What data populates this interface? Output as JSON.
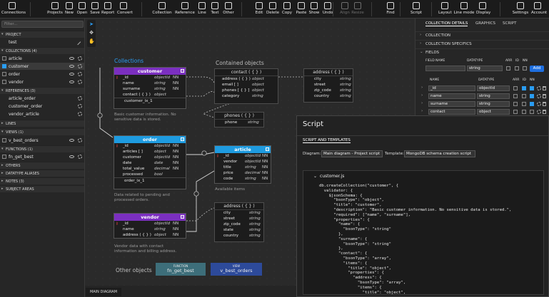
{
  "toolbar": {
    "items": [
      {
        "label": "Connections",
        "icon": "connections-icon",
        "enabled": true
      },
      {
        "label": "Projects",
        "icon": "projects-icon",
        "enabled": true
      },
      {
        "label": "New",
        "icon": "new-icon",
        "enabled": true
      },
      {
        "label": "Open",
        "icon": "open-icon",
        "enabled": true
      },
      {
        "label": "Save",
        "icon": "save-icon",
        "enabled": true
      },
      {
        "label": "Report",
        "icon": "report-icon",
        "enabled": true
      },
      {
        "label": "Convert",
        "icon": "convert-icon",
        "enabled": true
      },
      {
        "label": "Collection",
        "icon": "collection-icon",
        "enabled": true
      },
      {
        "label": "Reference",
        "icon": "reference-icon",
        "enabled": true
      },
      {
        "label": "Line",
        "icon": "line-icon",
        "enabled": true
      },
      {
        "label": "Text",
        "icon": "text-icon",
        "enabled": true
      },
      {
        "label": "Other",
        "icon": "other-icon",
        "enabled": true
      },
      {
        "label": "Edit",
        "icon": "edit-icon",
        "enabled": true
      },
      {
        "label": "Delete",
        "icon": "delete-icon",
        "enabled": true
      },
      {
        "label": "Copy",
        "icon": "copy-icon",
        "enabled": true
      },
      {
        "label": "Paste",
        "icon": "paste-icon",
        "enabled": true
      },
      {
        "label": "Show",
        "icon": "show-icon",
        "enabled": true
      },
      {
        "label": "Undo",
        "icon": "undo-icon",
        "enabled": true
      },
      {
        "label": "Align",
        "icon": "align-icon",
        "enabled": false
      },
      {
        "label": "Resize",
        "icon": "resize-icon",
        "enabled": false
      },
      {
        "label": "Find",
        "icon": "find-icon",
        "enabled": true
      },
      {
        "label": "Script",
        "icon": "script-icon",
        "enabled": true
      },
      {
        "label": "Layout",
        "icon": "layout-icon",
        "enabled": true
      },
      {
        "label": "Line mode",
        "icon": "line-mode-icon",
        "enabled": true
      },
      {
        "label": "Display",
        "icon": "display-icon",
        "enabled": true
      },
      {
        "label": "Settings",
        "icon": "settings-icon",
        "enabled": true
      },
      {
        "label": "Account",
        "icon": "account-icon",
        "enabled": true
      }
    ]
  },
  "left": {
    "search_placeholder": "Filter...",
    "project_header": "PROJECT",
    "project_name": "test",
    "collections_header": "COLLECTIONS",
    "collections_count": "(4)",
    "collections": [
      {
        "name": "article",
        "checked": false
      },
      {
        "name": "customer",
        "checked": true
      },
      {
        "name": "order",
        "checked": false
      },
      {
        "name": "vendor",
        "checked": false
      }
    ],
    "references_header": "REFERENCES",
    "references_count": "(3)",
    "references": [
      "article_order",
      "customer_order",
      "vendor_article"
    ],
    "lines_header": "LINES",
    "views_header": "VIEWS",
    "views_count": "(1)",
    "views": [
      "v_best_orders"
    ],
    "functions_header": "FUNCTIONS",
    "functions_count": "(1)",
    "functions": [
      "fn_get_best"
    ],
    "others_header": "OTHERS",
    "datatype_header": "DATATYPE ALIASES",
    "notes_header": "NOTES",
    "notes_count": "(3)",
    "subject_header": "SUBJECT AREAS"
  },
  "diagram": {
    "collections_title": "Collections",
    "contained_title": "Contained objects",
    "other_title": "Other objects",
    "customer": {
      "name": "customer",
      "color": "#7b2fc0",
      "rows": [
        {
          "key": "🔑",
          "name": "_id",
          "type": "objectId",
          "flag": "NN"
        },
        {
          "key": "",
          "name": "name",
          "type": "string",
          "flag": "NN"
        },
        {
          "key": "",
          "name": "surname",
          "type": "string",
          "flag": "NN"
        },
        {
          "key": "",
          "name": "contact ( { } )",
          "type": "object",
          "flag": ""
        }
      ],
      "index": "customer_ix_1",
      "note": "Basic customer information. No sensitive data is stored."
    },
    "order": {
      "name": "order",
      "color": "#1e9be0",
      "rows": [
        {
          "key": "🔑",
          "name": "_id",
          "type": "objectId",
          "flag": "NN"
        },
        {
          "key": "",
          "name": "articles [ ]",
          "type": "object",
          "flag": "NN"
        },
        {
          "key": "",
          "name": "customer",
          "type": "objectId",
          "flag": "NN"
        },
        {
          "key": "",
          "name": "date",
          "type": "date",
          "flag": "NN"
        },
        {
          "key": "",
          "name": "total_value",
          "type": "decimal",
          "flag": "NN"
        },
        {
          "key": "",
          "name": "processed",
          "type": "bool",
          "flag": ""
        }
      ],
      "index": "order_ix_1",
      "note": "Data related to pending and processed orders."
    },
    "vendor": {
      "name": "vendor",
      "color": "#7b2fc0",
      "rows": [
        {
          "key": "🔑",
          "name": "_id",
          "type": "objectId",
          "flag": "NN"
        },
        {
          "key": "",
          "name": "name",
          "type": "string",
          "flag": "NN"
        },
        {
          "key": "",
          "name": "address ( { } )",
          "type": "object",
          "flag": "NN"
        }
      ],
      "note": "Vendor data with contact information and billing address."
    },
    "article": {
      "name": "article",
      "color": "#1e9be0",
      "rows": [
        {
          "key": "🔑",
          "name": "_id",
          "type": "objectId",
          "flag": "NN"
        },
        {
          "key": "",
          "name": "vendor",
          "type": "objectId",
          "flag": "NN"
        },
        {
          "key": "",
          "name": "title",
          "type": "string",
          "flag": "NN"
        },
        {
          "key": "",
          "name": "price",
          "type": "decimal",
          "flag": "NN"
        },
        {
          "key": "",
          "name": "code",
          "type": "string",
          "flag": "NN"
        }
      ],
      "note": "Available items"
    },
    "contact": {
      "name": "contact ( { } )",
      "rows": [
        {
          "name": "address ( { } )",
          "type": "object"
        },
        {
          "name": "email [ ]",
          "type": "object"
        },
        {
          "name": "phones [ { } ]",
          "type": "object"
        },
        {
          "name": "category",
          "type": "string"
        }
      ]
    },
    "address1": {
      "name": "address ( { } )",
      "rows": [
        {
          "name": "city",
          "type": "string"
        },
        {
          "name": "street",
          "type": "string"
        },
        {
          "name": "zip_code",
          "type": "string"
        },
        {
          "name": "country",
          "type": "string"
        }
      ]
    },
    "phones": {
      "name": "phones ( { } )",
      "rows": [
        {
          "name": "phone",
          "type": "string"
        }
      ]
    },
    "address2": {
      "name": "address ( { } )",
      "rows": [
        {
          "name": "city",
          "type": "string"
        },
        {
          "name": "street",
          "type": "string"
        },
        {
          "name": "zip_code",
          "type": "string"
        },
        {
          "name": "state",
          "type": "string"
        },
        {
          "name": "country",
          "type": "string"
        }
      ]
    },
    "fn_box": {
      "caption": "FUNCTION",
      "name": "fn_get_best",
      "color": "#3d6e7a"
    },
    "view_box": {
      "caption": "VIEW",
      "name": "v_best_orders",
      "color": "#2d4a9a"
    },
    "bottom_tab": "MAIN DIAGRAM"
  },
  "right": {
    "tabs": [
      "COLLECTION DETAILS",
      "GRAPHICS",
      "SCRIPT"
    ],
    "sections": [
      "COLLECTION",
      "COLLECTION SPECIFICS",
      "FIELDS"
    ],
    "field_name_label": "FIELD NAME",
    "datatype_label": "DATATYPE",
    "arr_label": "ARR",
    "id_label": "ID",
    "nn_label": "NN",
    "new_datatype": "string",
    "add_label": "Add",
    "header_name": "NAME",
    "header_datatype": "DATATYPE",
    "fields": [
      {
        "name": "_id",
        "type": "objectId",
        "arr": false,
        "id": true,
        "nn": true
      },
      {
        "name": "name",
        "type": "string",
        "arr": false,
        "id": false,
        "nn": true
      },
      {
        "name": "surname",
        "type": "string",
        "arr": false,
        "id": false,
        "nn": true
      },
      {
        "name": "contact",
        "type": "object",
        "arr": false,
        "id": false,
        "nn": false
      }
    ]
  },
  "script": {
    "title": "Script",
    "tab": "SCRIPT AND TEMPLATES",
    "diagram_label": "Diagram:",
    "diagram_value": "Main diagram - Project script",
    "template_label": "Template:",
    "template_value": "MongoDB schema creation script",
    "file": "customer.js",
    "lines": [
      "db.createCollection(\"customer\", {",
      "  validator: {",
      "    $jsonSchema: {",
      "      \"bsonType\": \"object\",",
      "      \"title\": \"customer\",",
      "      \"description\": \"Basic customer information. No sensitive data is stored.\",",
      "      \"required\": [\"name\", \"surname\"],",
      "      \"properties\": {",
      "        \"name\": {",
      "          \"bsonType\": \"string\"",
      "        },",
      "        \"surname\": {",
      "          \"bsonType\": \"string\"",
      "        },",
      "        \"contact\": {",
      "          \"bsonType\": \"array\",",
      "          \"items\": {",
      "            \"title\": \"object\",",
      "            \"properties\": {",
      "              \"address\": {",
      "                \"bsonType\": \"array\",",
      "                \"items\": {",
      "                  \"title\": \"object\","
    ]
  }
}
